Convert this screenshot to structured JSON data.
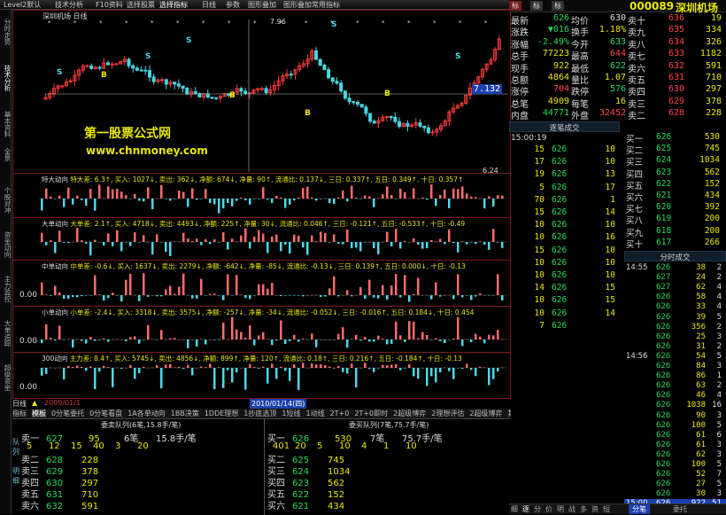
{
  "toolbar": {
    "items": [
      "Level2默认",
      "技术分析",
      "F10资料",
      "选择股票",
      "选择指标",
      "日线",
      "参数",
      "图形叠加",
      "图形叠加",
      "常用指标"
    ]
  },
  "left_tabs": [
    "分时走势",
    "技术分析",
    "基本资料",
    "全景",
    "个股对冲",
    "资金动向",
    "主力监控",
    "大单追踪",
    "超级资金"
  ],
  "chart": {
    "title_label": "深圳机场 日线",
    "watermark_line1": "第一股票公式网",
    "watermark_line2": "www.chnmoney.com",
    "price_high": "7.96",
    "price_box": "7.132",
    "price_low": "6.24",
    "panels": [
      {
        "name": "特大动向",
        "text": "特大差: 6.3↑, 买入: 1027↓, 卖出: 362↓, 净额: 674↓, 净量: 90↑, 流通比: 0.137↓, 三日: 0.337↑, 五日: 0.349↑, 十日: 0.357↑"
      },
      {
        "name": "大单动向",
        "text": "大单差: 2.1↑, 买入: 4718↓, 卖出: 4493↓, 净额: 225↑, 净量: 30↓, 流通比: 0.046↑, 三日: -0.121↑, 五日: -0.533↑, 十日: -0.49"
      },
      {
        "name": "中单动向",
        "text": "中单差: -0.6↓, 买入: 1637↓, 卖出: 2279↓, 净额: -642↓, 净量: -85↓, 流通比: -0.13↓, 三日: 0.139↑, 五日: 0.000↓, 十日: -0.13"
      },
      {
        "name": "小单动向",
        "text": "小单差: -2.4↓, 买入: 3318↓, 卖出: 3575↓, 净额: -257↓, 净量: -34↓, 流通比: -0.052↓, 三日: -0.016↑, 五日: 0.184↓, 十日: 0.454"
      },
      {
        "name": "300动向",
        "text": "主力差: 8.4↑, 买入: 5745↓, 卖出: 4856↓, 净额: 899↑, 净量: 120↑, 流通比: 0.18↑, 三日: 0.216↑, 五日: -0.184↑, 十日: -0.13"
      }
    ],
    "zero_labels": [
      "0.00",
      "0.00",
      "0.00"
    ],
    "dates": [
      "2009/01/1",
      "2010/01/14(四)"
    ],
    "date_tab": "日线"
  },
  "bottom_tabs": [
    "指标",
    "模板",
    "0分笔委托",
    "0分笔看盘",
    "1A各单动向",
    "1BB决策",
    "1DDE理想",
    "1抄底选顶",
    "1短线",
    "1动线",
    "2T+0",
    "2T+0即时",
    "2超级博弈",
    "2理想评估",
    "2超级博弈",
    "其他"
  ],
  "queue": {
    "left_title": "委卖队列(6笔,15.8手/笔)",
    "right_title": "委买队列(7笔,75.7手/笔)",
    "left_top": {
      "label": "卖一",
      "price": "627",
      "vol": "95",
      "count": "6笔",
      "avg": "15.8手/笔"
    },
    "left_nums": [
      "5",
      "12",
      "15",
      "40",
      "3",
      "20"
    ],
    "left_rows": [
      [
        "卖二",
        "628",
        "228"
      ],
      [
        "卖三",
        "629",
        "378"
      ],
      [
        "卖四",
        "630",
        "297"
      ],
      [
        "卖五",
        "631",
        "710"
      ],
      [
        "卖六",
        "632",
        "591"
      ]
    ],
    "right_top": {
      "label": "买一",
      "price": "626",
      "vol": "530",
      "count": "7笔",
      "avg": "75.7手/笔"
    },
    "right_nums": [
      "401",
      "20",
      "5",
      "10",
      "4",
      "1",
      "10"
    ],
    "right_rows": [
      [
        "买二",
        "625",
        "745"
      ],
      [
        "买三",
        "624",
        "1034"
      ],
      [
        "买四",
        "623",
        "562"
      ],
      [
        "买五",
        "622",
        "152"
      ],
      [
        "买六",
        "621",
        "434"
      ]
    ],
    "side_labels": [
      "队列",
      "明细",
      "其他"
    ]
  },
  "stock": {
    "code": "000089",
    "name": "深圳机场",
    "tabs": [
      "标",
      "标",
      "标"
    ]
  },
  "quote_left": [
    [
      "最新",
      "626"
    ],
    [
      "涨跌",
      "▼016"
    ],
    [
      "涨幅",
      "-2.49%"
    ],
    [
      "总手",
      "77223"
    ],
    [
      "现手",
      "922"
    ],
    [
      "总额",
      "4864"
    ],
    [
      "涨停",
      "704"
    ],
    [
      "总笔",
      "4909"
    ],
    [
      "内盘",
      "44771"
    ]
  ],
  "quote_mid": [
    [
      "均价",
      "630"
    ],
    [
      "换手",
      "1.18%"
    ],
    [
      "今开",
      "633"
    ],
    [
      "最高",
      "644"
    ],
    [
      "最低",
      "622"
    ],
    [
      "量比",
      "1.07"
    ],
    [
      "跌停",
      "576"
    ],
    [
      "每笔",
      "16"
    ],
    [
      "外盘",
      "32452"
    ]
  ],
  "quote_right": [
    [
      "卖十",
      "636"
    ],
    [
      "卖九",
      "635"
    ],
    [
      "卖八",
      "634"
    ],
    [
      "卖七",
      "633"
    ],
    [
      "卖六",
      "632"
    ],
    [
      "卖五",
      "631"
    ],
    [
      "卖四",
      "630"
    ],
    [
      "卖三",
      "629"
    ],
    [
      "卖二",
      "628"
    ]
  ],
  "quote_right_vols": [
    "19",
    "334",
    "326",
    "1182",
    "591",
    "710",
    "297",
    "378",
    "228"
  ],
  "trade_head": "逐笔成交",
  "trade_time": "15:00:19",
  "trades_left": [
    [
      "626",
      "15"
    ],
    [
      "626",
      "17"
    ],
    [
      "626",
      "19"
    ],
    [
      "626",
      "5"
    ],
    [
      "626",
      "70"
    ],
    [
      "626",
      "15"
    ],
    [
      "626",
      "10"
    ],
    [
      "626",
      "10"
    ],
    [
      "626",
      "15"
    ],
    [
      "626",
      "10"
    ],
    [
      "626",
      "10"
    ],
    [
      "626",
      "14"
    ],
    [
      "626",
      "10"
    ],
    [
      "626",
      "10"
    ],
    [
      "626",
      "7"
    ]
  ],
  "trades_left_nums": [
    "15",
    "17",
    "19",
    "5",
    "70",
    "15",
    "10",
    "10",
    "15",
    "10",
    "10",
    "14",
    "10",
    "10",
    "7"
  ],
  "trades_mid": [
    "10",
    "10",
    "13",
    "17",
    "1",
    "14",
    "10",
    "16",
    "10",
    "10",
    "10",
    "15",
    "15",
    "14"
  ],
  "bid_ask": [
    [
      "买一",
      "626",
      "530"
    ],
    [
      "买二",
      "625",
      "745"
    ],
    [
      "买三",
      "624",
      "1034"
    ],
    [
      "买四",
      "623",
      "562"
    ],
    [
      "买五",
      "622",
      "152"
    ],
    [
      "买六",
      "621",
      "434"
    ],
    [
      "买七",
      "620",
      "392"
    ],
    [
      "买八",
      "619",
      "200"
    ],
    [
      "买九",
      "618",
      "200"
    ],
    [
      "买十",
      "617",
      "266"
    ]
  ],
  "minute_head": "分时成交",
  "minute_rows": [
    [
      "14:55",
      "626",
      "38",
      "2"
    ],
    [
      "",
      "627",
      "24",
      "2"
    ],
    [
      "",
      "627",
      "62",
      "4"
    ],
    [
      "",
      "626",
      "58",
      "4"
    ],
    [
      "",
      "626",
      "33",
      "4"
    ],
    [
      "",
      "626",
      "39",
      "5"
    ],
    [
      "",
      "626",
      "356",
      "2"
    ],
    [
      "",
      "626",
      "25",
      "3"
    ],
    [
      "",
      "626",
      "31",
      "2"
    ],
    [
      "14:56",
      "626",
      "54",
      "5"
    ],
    [
      "",
      "626",
      "84",
      "3"
    ],
    [
      "",
      "626",
      "86",
      "1"
    ],
    [
      "",
      "626",
      "63",
      "2"
    ],
    [
      "",
      "626",
      "46",
      "4"
    ],
    [
      "",
      "626",
      "1038",
      "16"
    ],
    [
      "",
      "626",
      "90",
      "3"
    ],
    [
      "",
      "626",
      "100",
      "5"
    ],
    [
      "",
      "626",
      "61",
      "6"
    ],
    [
      "",
      "626",
      "61",
      "3"
    ],
    [
      "",
      "626",
      "62",
      "3"
    ],
    [
      "",
      "626",
      "100",
      "5"
    ],
    [
      "",
      "626",
      "52",
      "7"
    ],
    [
      "",
      "626",
      "27",
      "5"
    ],
    [
      "",
      "626",
      "30",
      "3"
    ]
  ],
  "minute_last": [
    "15:00",
    "626",
    "922",
    "51"
  ],
  "bottom_right_tabs": [
    "细",
    "逐",
    "分",
    "价",
    "明",
    "战",
    "多",
    "资",
    "短"
  ],
  "bottom_right_tabs2": [
    "分笔",
    "委托"
  ]
}
